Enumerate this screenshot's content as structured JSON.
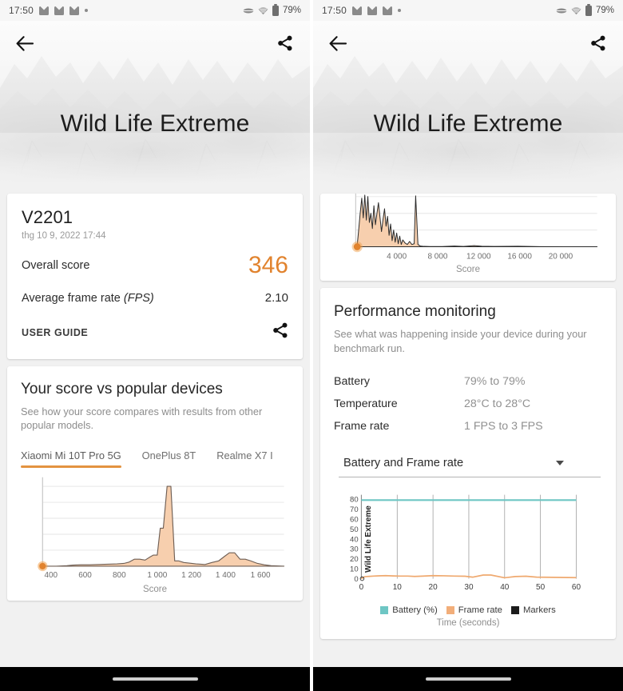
{
  "statusbar": {
    "time": "17:50",
    "battery_percent": "79%",
    "icons": [
      "mail-icon",
      "mail-icon",
      "mail-icon",
      "dot-icon",
      "network-icon",
      "wifi-icon",
      "battery-icon"
    ]
  },
  "appbar": {
    "back_label": "back-arrow",
    "share_label": "share"
  },
  "hero": {
    "title": "Wild Life Extreme"
  },
  "left": {
    "score_card": {
      "device": "V2201",
      "date": "thg 10 9, 2022 17:44",
      "overall_label": "Overall score",
      "overall_value": "346",
      "fps_label": "Average frame rate",
      "fps_label_em": "(FPS)",
      "fps_value": "2.10",
      "user_guide": "USER GUIDE"
    },
    "compare_card": {
      "title": "Your score vs popular devices",
      "subtitle": "See how your score compares with results from other popular models.",
      "tabs": [
        {
          "label": "Xiaomi Mi 10T Pro 5G",
          "active": true
        },
        {
          "label": "OnePlus 8T",
          "active": false
        },
        {
          "label": "Realme X7 I",
          "active": false
        }
      ]
    }
  },
  "right": {
    "perf_card": {
      "title": "Performance monitoring",
      "subtitle": "See what was happening inside your device during your benchmark run.",
      "rows": [
        {
          "key": "Battery",
          "value": "79% to 79%"
        },
        {
          "key": "Temperature",
          "value": "28°C to 28°C"
        },
        {
          "key": "Frame rate",
          "value": "1 FPS to 3 FPS"
        }
      ],
      "select_value": "Battery and Frame rate"
    }
  },
  "colors": {
    "accent_orange": "#e1832e",
    "chart_fill": "#f7cfae",
    "chart_stroke": "#6f5f55",
    "battery_teal": "#6ec6c4",
    "frame_orange": "#f2ae7a",
    "marker_black": "#1b1b1b",
    "tab_underline": "#e39340",
    "grid": "#e3e3e3"
  },
  "chart_data": [
    {
      "id": "left-distribution",
      "type": "area",
      "title": "",
      "xlabel": "Score",
      "ylabel": "",
      "xlim": [
        300,
        1700
      ],
      "ylim": [
        0,
        7
      ],
      "grid": true,
      "xticks": [
        400,
        600,
        800,
        1000,
        1200,
        1400,
        1600
      ],
      "xticklabels": [
        "400",
        "600",
        "800",
        "1 000",
        "1 200",
        "1 400",
        "1 600"
      ],
      "gridlines_y": 6,
      "marker": {
        "x": 346,
        "y": 0,
        "label": "346",
        "color": "#e1832e"
      },
      "x": [
        300,
        400,
        500,
        560,
        600,
        650,
        700,
        750,
        800,
        840,
        870,
        900,
        930,
        960,
        990,
        1010,
        1030,
        1050,
        1070,
        1090,
        1110,
        1130,
        1150,
        1180,
        1210,
        1250,
        1300,
        1340,
        1380,
        1410,
        1440,
        1470,
        1500,
        1530,
        1560,
        1600,
        1640,
        1680
      ],
      "values": [
        0,
        0,
        0.02,
        0.05,
        0.07,
        0.07,
        0.08,
        0.09,
        0.1,
        0.12,
        0.2,
        0.35,
        0.35,
        0.3,
        0.45,
        0.55,
        0.55,
        2.2,
        2.2,
        6.6,
        6.6,
        0.3,
        0.3,
        0.22,
        0.18,
        0.15,
        0.12,
        0.2,
        0.3,
        0.55,
        0.8,
        0.8,
        0.45,
        0.45,
        0.3,
        0.15,
        0.08,
        0.03
      ]
    },
    {
      "id": "right-distribution",
      "type": "area",
      "title": "",
      "xlabel": "Score",
      "ylabel": "",
      "xlim": [
        0,
        23500
      ],
      "ylim": [
        0,
        10
      ],
      "grid": true,
      "xticks": [
        4000,
        8000,
        12000,
        16000,
        20000
      ],
      "xticklabels": [
        "4 000",
        "8 000",
        "12 000",
        "16 000",
        "20 000"
      ],
      "marker": {
        "x": 346,
        "y": 0,
        "label": "346",
        "color": "#e1832e"
      },
      "x": [
        200,
        350,
        500,
        620,
        700,
        800,
        880,
        960,
        1050,
        1150,
        1250,
        1350,
        1450,
        1560,
        1650,
        1750,
        1850,
        1950,
        2050,
        2150,
        2280,
        2400,
        2520,
        2650,
        2780,
        2900,
        3050,
        3200,
        3350,
        3500,
        3700,
        3900,
        4100,
        4300,
        4500,
        4700,
        4900,
        5050,
        5200,
        5400,
        5700,
        6200,
        7000,
        8000,
        9000,
        9600,
        10400,
        11000,
        12000,
        14000,
        16000,
        18000,
        19000,
        21000,
        23000
      ],
      "values": [
        0.3,
        3.2,
        6.5,
        9.2,
        5.4,
        9.8,
        5.0,
        9.5,
        4.4,
        8.9,
        6.2,
        3.4,
        7.8,
        4.2,
        6.2,
        8.4,
        5.6,
        2.8,
        5.2,
        7.2,
        3.4,
        5.4,
        2.0,
        4.3,
        1.2,
        3.1,
        0.8,
        2.4,
        0.55,
        1.9,
        0.4,
        1.1,
        0.7,
        0.45,
        0.95,
        0.4,
        0.6,
        9.6,
        0.25,
        0.1,
        0.06,
        0.05,
        0.05,
        0.05,
        0.12,
        0.06,
        0.2,
        0.07,
        0.05,
        0.04,
        0.04,
        0.1,
        0.03,
        0.02,
        0.01
      ]
    },
    {
      "id": "perf-monitor",
      "type": "line",
      "title": "",
      "xlabel": "Time (seconds)",
      "ylabel": "Wild Life Extreme",
      "xlim": [
        0,
        61
      ],
      "ylim": [
        0,
        85
      ],
      "grid": true,
      "xticks": [
        0,
        10,
        20,
        30,
        40,
        50,
        60
      ],
      "xticklabels": [
        "0",
        "10",
        "20",
        "30",
        "40",
        "50",
        "60"
      ],
      "yticks": [
        0,
        10,
        20,
        30,
        40,
        50,
        60,
        70,
        80
      ],
      "yticklabels": [
        "0",
        "10",
        "20",
        "30",
        "40",
        "50",
        "60",
        "70",
        "80"
      ],
      "legend": [
        {
          "name": "Battery (%)",
          "color": "#6ec6c4"
        },
        {
          "name": "Frame rate",
          "color": "#f2ae7a"
        },
        {
          "name": "Markers",
          "color": "#1b1b1b"
        }
      ],
      "legend_position": "bottom",
      "series": [
        {
          "name": "Battery (%)",
          "color": "#6ec6c4",
          "x": [
            0,
            5,
            10,
            15,
            20,
            25,
            30,
            35,
            40,
            45,
            50,
            55,
            60
          ],
          "values": [
            79,
            79,
            79,
            79,
            79,
            79,
            79,
            79,
            79,
            79,
            79,
            79,
            79
          ]
        },
        {
          "name": "Frame rate",
          "color": "#f2ae7a",
          "x": [
            0,
            2,
            4,
            7,
            10,
            13,
            16,
            19,
            22,
            25,
            28,
            31,
            34,
            37,
            40,
            42,
            45,
            47,
            50,
            53,
            56,
            59,
            60
          ],
          "values": [
            0,
            2.0,
            2.2,
            2.4,
            2.5,
            2.6,
            2.4,
            2.3,
            2.3,
            2.0,
            2.2,
            2.6,
            2.5,
            2.3,
            2.2,
            1.6,
            2.9,
            2.9,
            1.2,
            1.8,
            2.0,
            1.5,
            1.1
          ]
        }
      ]
    }
  ]
}
